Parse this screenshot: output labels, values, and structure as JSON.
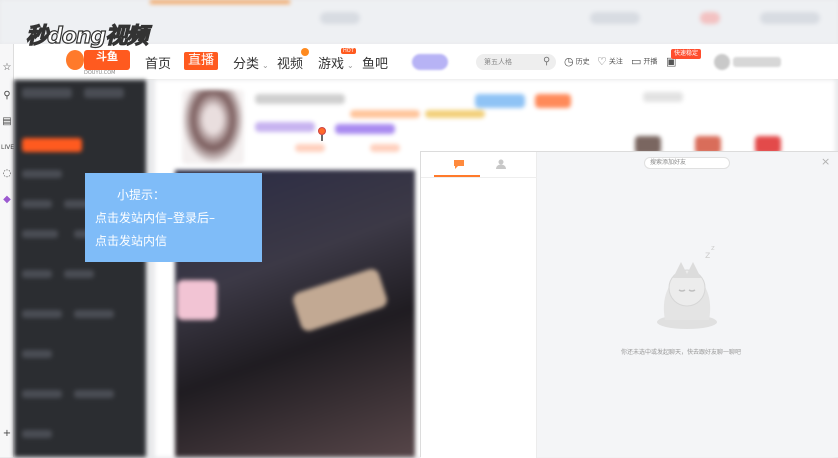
{
  "watermark": {
    "text": "秒dong视频"
  },
  "header": {
    "logo_text": "斗鱼",
    "logo_sub": "DOUYU.COM",
    "nav": {
      "home": "首页",
      "live": "直播",
      "category": "分类",
      "video": "视频",
      "game": "游戏",
      "game_hot": "HOT",
      "yuba": "鱼吧"
    },
    "search_placeholder": "第五人格",
    "tools": {
      "history": "历史",
      "follow": "关注",
      "broadcast": "开播"
    },
    "quick_badge": "快速稳定"
  },
  "tip": {
    "title": "小提示：",
    "line1": "点击发站内信–登录后–",
    "line2": "点击发站内信"
  },
  "message_panel": {
    "add_friend_placeholder": "搜索添加好友",
    "empty_text": "你还未选中或发起聊天，快去跟好友聊一聊吧",
    "close_label": "×"
  },
  "colors": {
    "brand_orange": "#ff5a1f",
    "tip_blue": "#7fbcf8",
    "sidebar_dark": "#2b2d31"
  }
}
